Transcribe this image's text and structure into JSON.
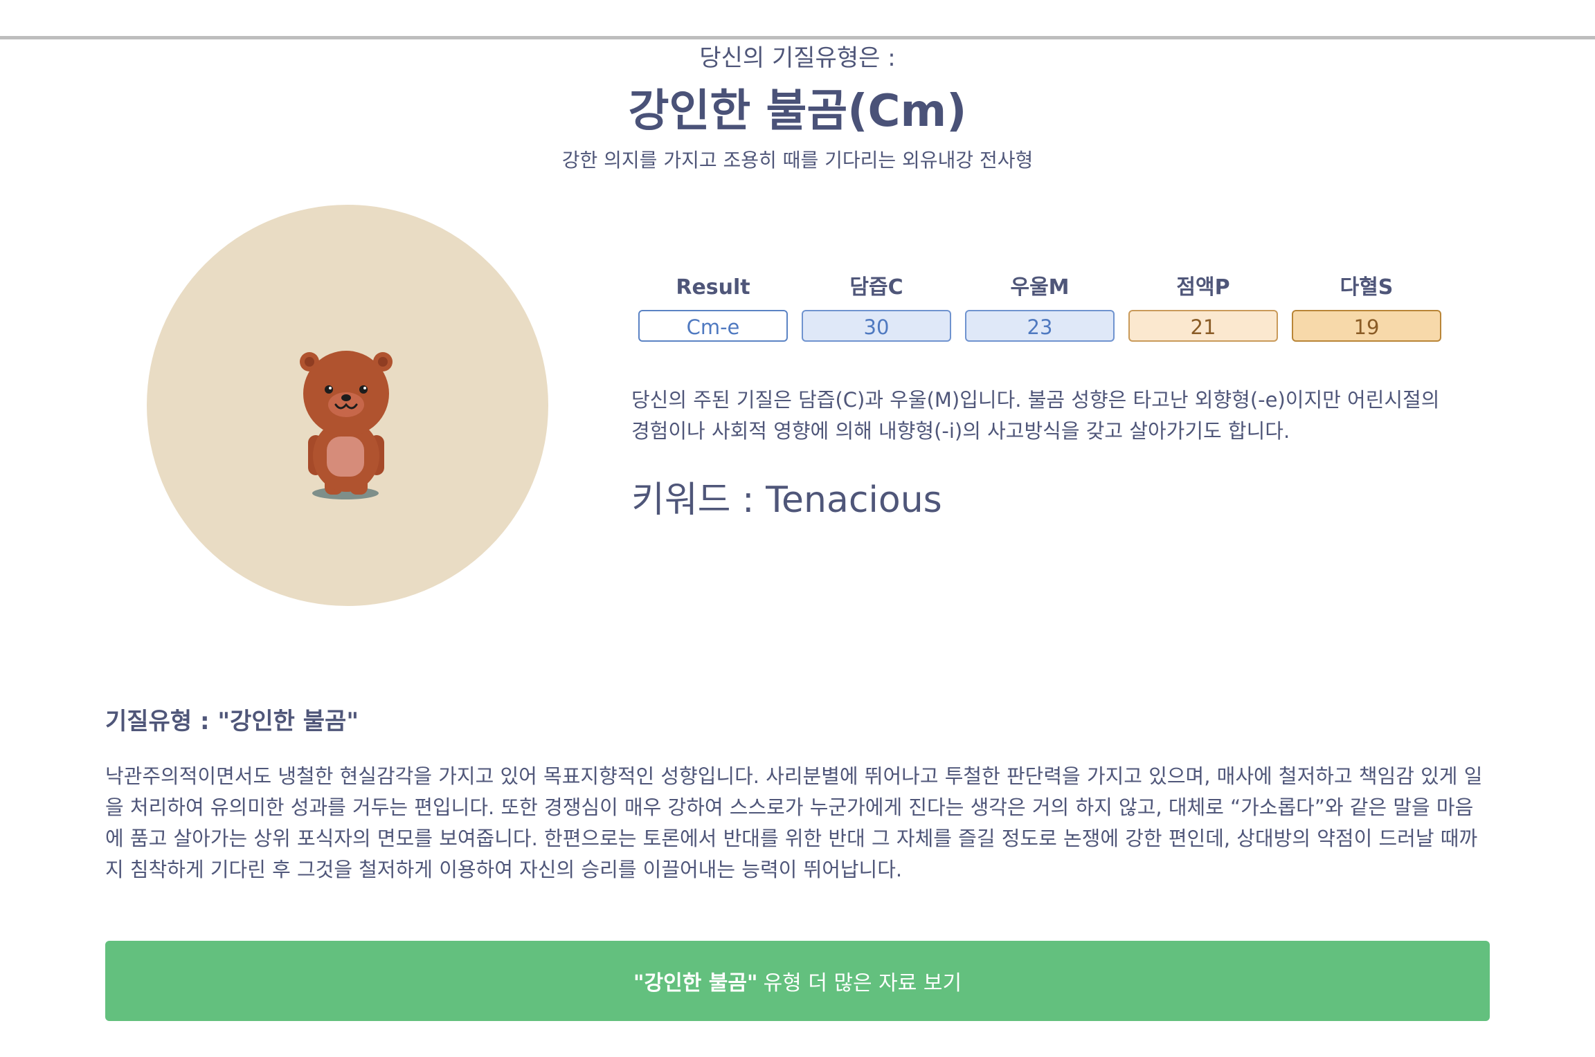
{
  "header": {
    "lead": "당신의 기질유형은 :",
    "title": "강인한 불곰(Cm)",
    "subtitle": "강한 의지를 가지고 조용히 때를 기다리는 외유내강 전사형"
  },
  "avatar": {
    "icon": "brown-bear-icon",
    "bg_color": "#e9dcc4"
  },
  "scores": [
    {
      "label": "Result",
      "value": "Cm-e"
    },
    {
      "label": "담즙C",
      "value": "30"
    },
    {
      "label": "우울M",
      "value": "23"
    },
    {
      "label": "점액P",
      "value": "21"
    },
    {
      "label": "다혈S",
      "value": "19"
    }
  ],
  "description": "당신의 주된 기질은 담즙(C)과 우울(M)입니다. 불곰 성향은 타고난 외향형(-e)이지만 어린시절의 경험이나 사회적 영향에 의해 내향형(-i)의 사고방식을 갖고 살아가기도 합니다.",
  "keyword": "키워드 : Tenacious",
  "section": {
    "title": "기질유형 : \"강인한 불곰\"",
    "body": "낙관주의적이면서도 냉철한 현실감각을 가지고 있어 목표지향적인 성향입니다. 사리분별에 뛰어나고 투철한 판단력을 가지고 있으며, 매사에 철저하고 책임감 있게 일을 처리하여 유의미한 성과를 거두는 편입니다. 또한 경쟁심이 매우 강하여 스스로가 누군가에게 진다는 생각은 거의 하지 않고, 대체로 “가소롭다”와 같은 말을 마음에 품고 살아가는 상위 포식자의 면모를 보여줍니다. 한편으로는 토론에서 반대를 위한 반대 그 자체를 즐길 정도로 논쟁에 강한 편인데, 상대방의 약점이 드러날 때까지 침착하게 기다린 후 그것을 철저하게 이용하여 자신의 승리를 이끌어내는 능력이 뛰어납니다."
  },
  "more_button": {
    "bold": "\"강인한 불곰\"",
    "rest": "유형 더 많은 자료 보기",
    "color": "#63c07e"
  }
}
